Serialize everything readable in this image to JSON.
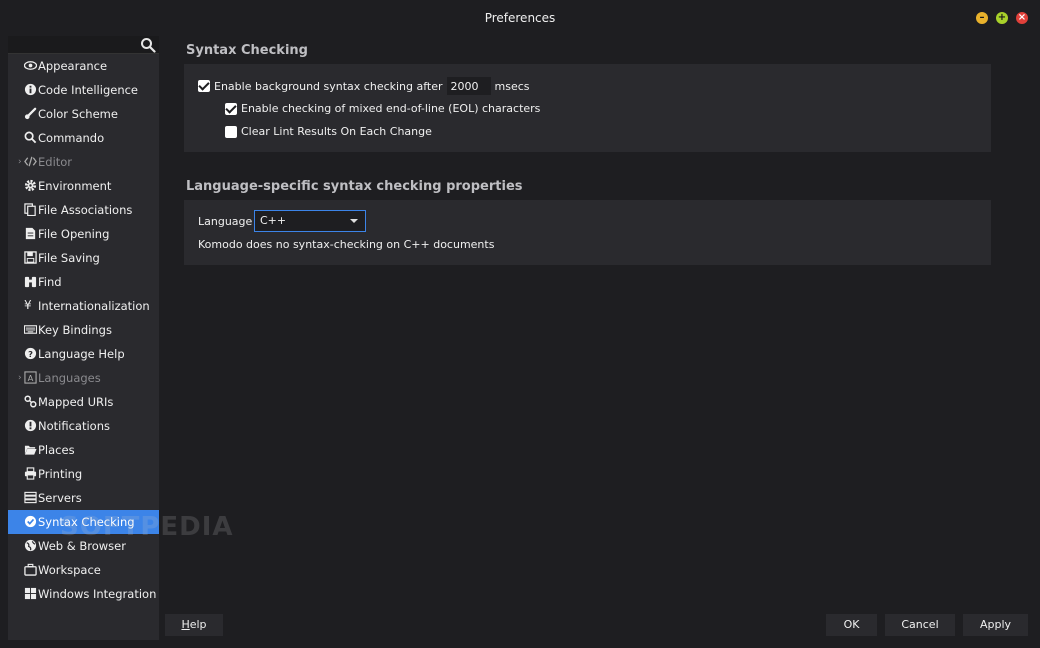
{
  "window": {
    "title": "Preferences"
  },
  "sidebar": {
    "items": [
      {
        "label": "Appearance",
        "icon": "eye-icon"
      },
      {
        "label": "Code Intelligence",
        "icon": "info-icon"
      },
      {
        "label": "Color Scheme",
        "icon": "brush-icon"
      },
      {
        "label": "Commando",
        "icon": "search-icon"
      },
      {
        "label": "Editor",
        "icon": "code-icon"
      },
      {
        "label": "Environment",
        "icon": "gear-icon"
      },
      {
        "label": "File Associations",
        "icon": "files-icon"
      },
      {
        "label": "File Opening",
        "icon": "file-icon"
      },
      {
        "label": "File Saving",
        "icon": "save-icon"
      },
      {
        "label": "Find",
        "icon": "binoculars-icon"
      },
      {
        "label": "Internationalization",
        "icon": "yen-icon"
      },
      {
        "label": "Key Bindings",
        "icon": "keyboard-icon"
      },
      {
        "label": "Language Help",
        "icon": "question-icon"
      },
      {
        "label": "Languages",
        "icon": "language-icon"
      },
      {
        "label": "Mapped URIs",
        "icon": "link-icon"
      },
      {
        "label": "Notifications",
        "icon": "alert-icon"
      },
      {
        "label": "Places",
        "icon": "folder-open-icon"
      },
      {
        "label": "Printing",
        "icon": "printer-icon"
      },
      {
        "label": "Servers",
        "icon": "server-icon"
      },
      {
        "label": "Syntax Checking",
        "icon": "check-circle-icon"
      },
      {
        "label": "Web & Browser",
        "icon": "globe-icon"
      },
      {
        "label": "Workspace",
        "icon": "briefcase-icon"
      },
      {
        "label": "Windows Integration",
        "icon": "windows-icon"
      }
    ],
    "selected": "Syntax Checking"
  },
  "syntax_checking": {
    "title": "Syntax Checking",
    "bg_check_label": "Enable background syntax checking after",
    "bg_check_checked": true,
    "delay_value": "2000",
    "delay_unit": "msecs",
    "eol_label": "Enable checking of mixed end-of-line (EOL) characters",
    "eol_checked": true,
    "clear_lint_label": "Clear Lint Results On Each Change",
    "clear_lint_checked": false
  },
  "language_props": {
    "title": "Language-specific syntax checking properties",
    "language_label": "Language",
    "language_value": "C++",
    "note": "Komodo does no syntax-checking on C++ documents"
  },
  "footer": {
    "help": "Help",
    "ok": "OK",
    "cancel": "Cancel",
    "apply": "Apply"
  },
  "watermark": "SOFTPEDIA",
  "colors": {
    "accent": "#3c84e8",
    "background": "#1e1e21",
    "panel": "#2a2a2e"
  }
}
